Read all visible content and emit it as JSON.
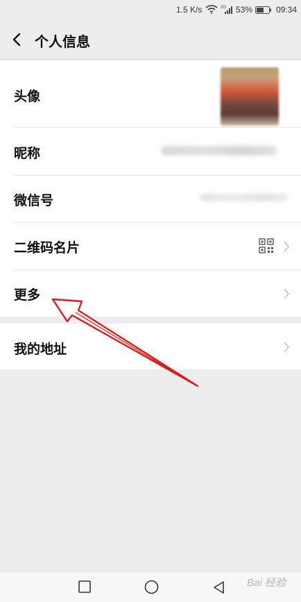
{
  "status_bar": {
    "net_speed": "1.5 K/s",
    "battery_percent": "53%",
    "time": "09:34",
    "network_type": "2G",
    "icons": [
      "wifi-icon",
      "signal-icon",
      "battery-icon"
    ]
  },
  "header": {
    "title": "个人信息",
    "back_icon": "back-arrow-icon"
  },
  "rows": {
    "avatar": {
      "label": "头像"
    },
    "nickname": {
      "label": "昵称"
    },
    "wechat_id": {
      "label": "微信号"
    },
    "qr_card": {
      "label": "二维码名片",
      "icon": "qr-code-icon"
    },
    "more": {
      "label": "更多"
    }
  },
  "address": {
    "label": "我的地址"
  },
  "nav_bar": {
    "buttons": [
      "recent-apps-icon",
      "home-icon",
      "back-triangle-icon"
    ]
  },
  "watermark": {
    "text": "Bai 经验"
  },
  "colors": {
    "background": "#ededed",
    "card": "#ffffff",
    "annotation_red": "#d91c1c",
    "chevron": "#c2c2c2"
  }
}
